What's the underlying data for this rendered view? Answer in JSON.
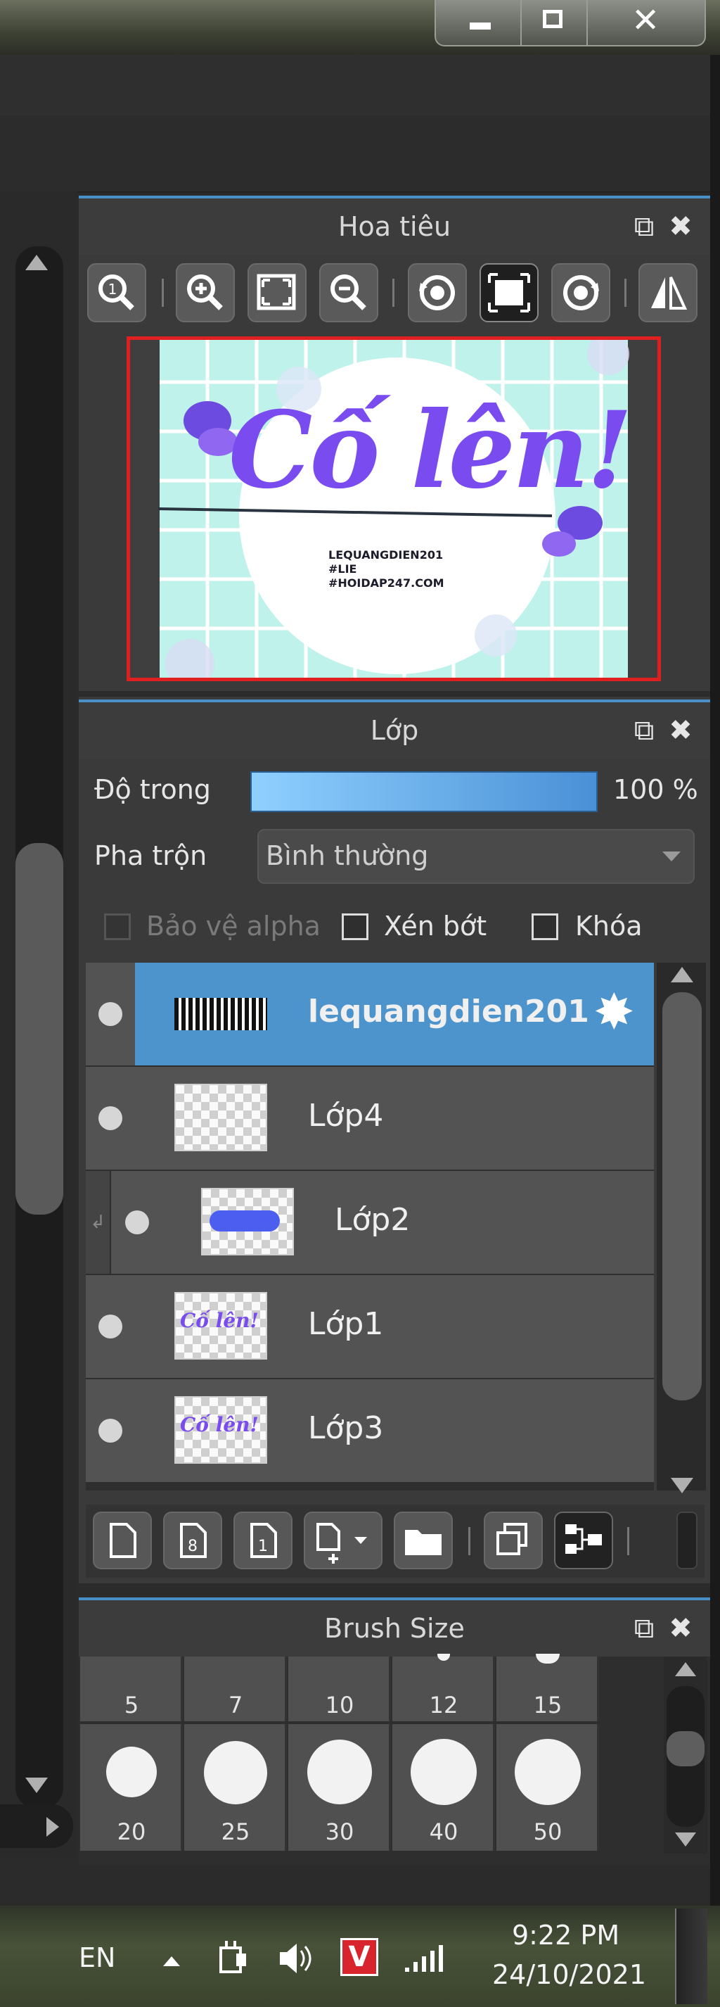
{
  "window_controls": {
    "minimize_icon": "minimize-icon",
    "maximize_icon": "restore-icon",
    "close_icon": "close-icon"
  },
  "navigator": {
    "title": "Hoa tiêu",
    "tools": [
      "zoom-fit-icon",
      "zoom-in-icon",
      "fit-screen-icon",
      "zoom-out-icon",
      "rotate-left-icon",
      "actual-size-icon",
      "rotate-right-icon",
      "flip-icon"
    ],
    "preview": {
      "big_text": "Cố lên!",
      "small_lines": [
        "LEQUANGDIEN201",
        "#LIE",
        "#HOIDAP247.COM"
      ]
    }
  },
  "layers": {
    "title": "Lớp",
    "opacity_label": "Độ trong",
    "opacity_value": "100 %",
    "opacity_fraction": 1.0,
    "blend_label": "Pha trộn",
    "blend_value": "Bình thường",
    "protect_alpha": "Bảo vệ alpha",
    "clip": "Xén bớt",
    "lock": "Khóa",
    "items": [
      {
        "name": "lequangdien201",
        "selected": true
      },
      {
        "name": "Lớp4",
        "selected": false
      },
      {
        "name": "Lớp2",
        "selected": false,
        "clipped": true
      },
      {
        "name": "Lớp1",
        "selected": false
      },
      {
        "name": "Lớp3",
        "selected": false
      }
    ],
    "toolbar": [
      "new-layer-icon",
      "new-8bit-layer-icon",
      "new-1bit-layer-icon",
      "add-layer-menu-icon",
      "folder-icon",
      "duplicate-icon",
      "merge-icon"
    ]
  },
  "brush_size": {
    "title": "Brush Size",
    "row1": [
      "5",
      "7",
      "10",
      "12",
      "15"
    ],
    "row2": [
      "20",
      "25",
      "30",
      "40",
      "50"
    ]
  },
  "taskbar": {
    "lang": "EN",
    "time": "9:22 PM",
    "date": "24/10/2021",
    "app_badge": "V"
  },
  "colors": {
    "accent": "#4e94cc",
    "preview_border": "#e02020",
    "purple": "#7a4cf0"
  }
}
